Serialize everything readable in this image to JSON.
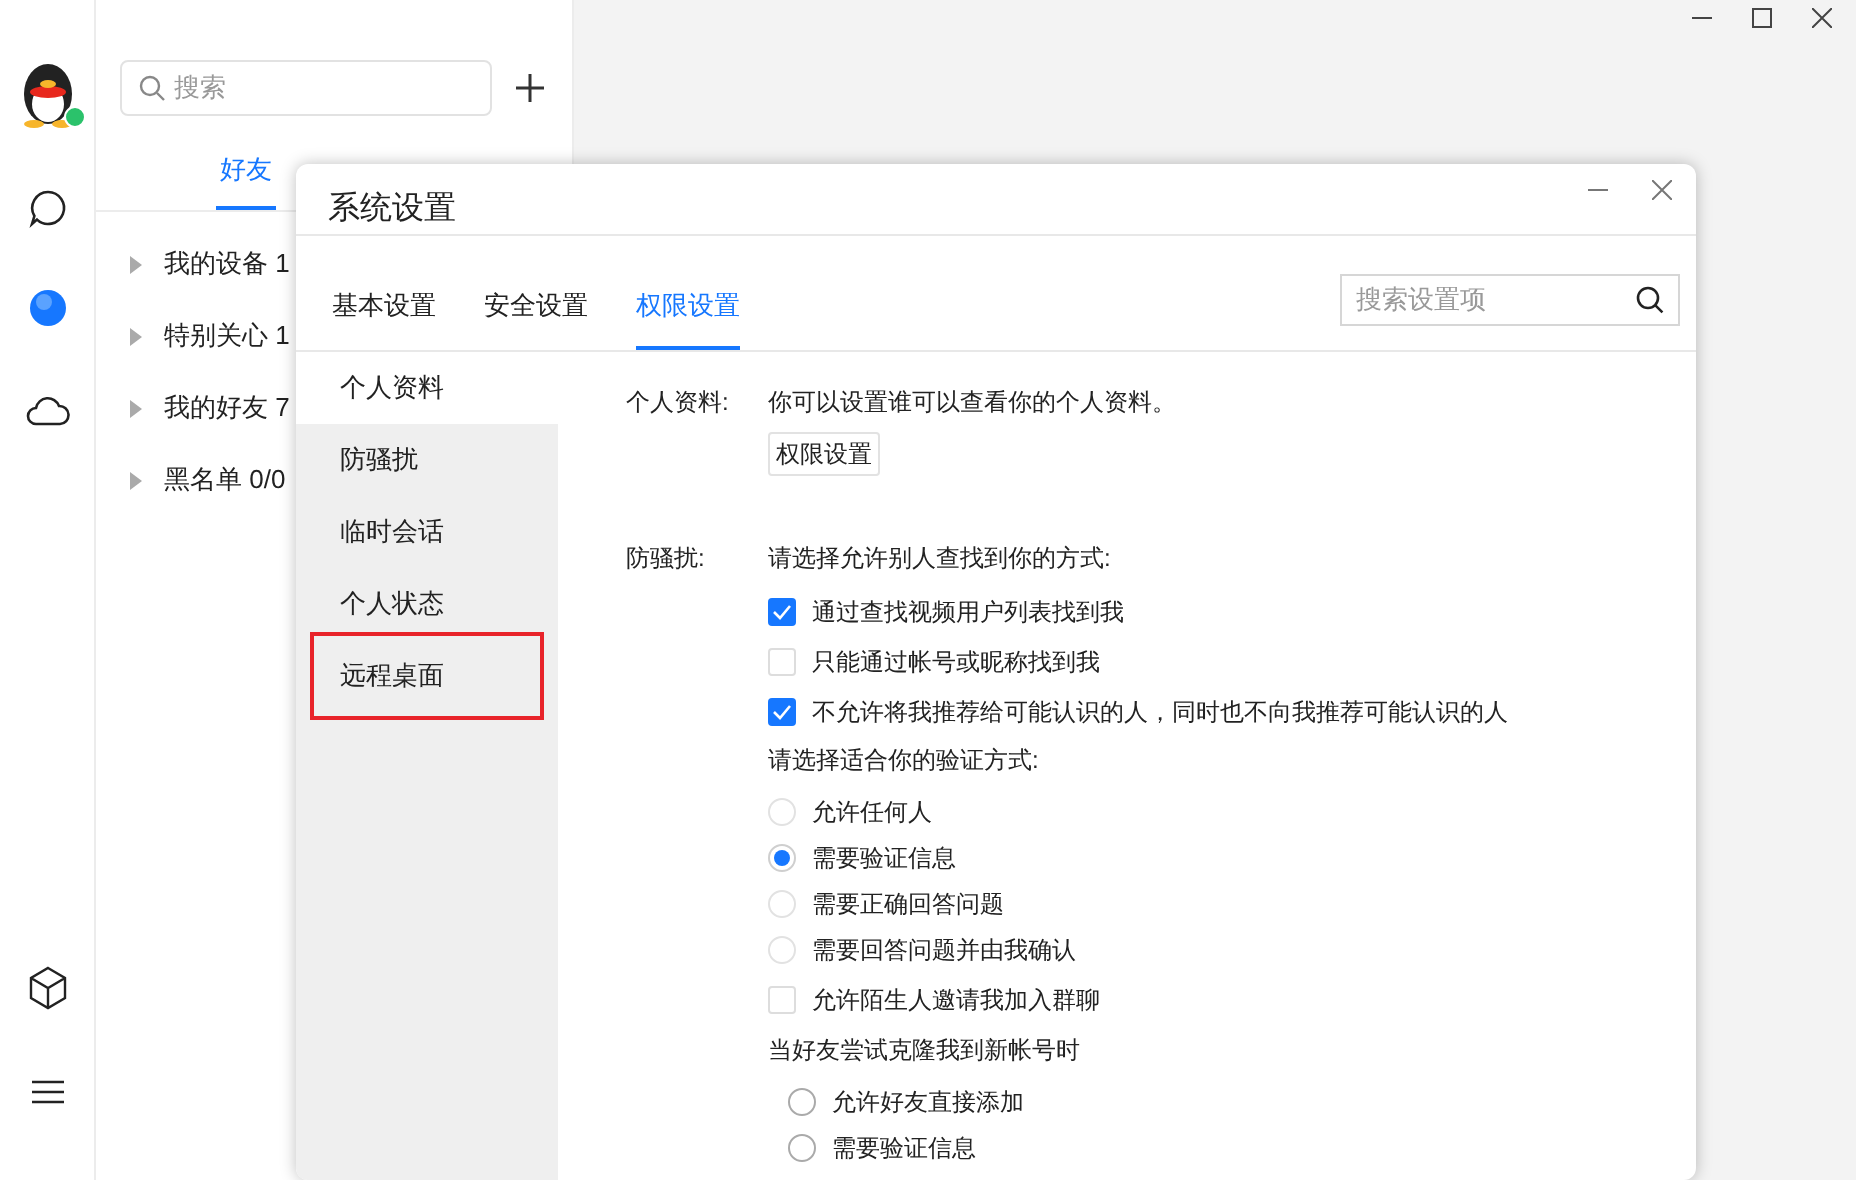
{
  "sidebar": {
    "online": true
  },
  "contacts": {
    "search_placeholder": "搜索",
    "tabs": [
      {
        "label": "好友",
        "selected": true
      }
    ],
    "groups": [
      {
        "label": "我的设备 1"
      },
      {
        "label": "特别关心 1"
      },
      {
        "label": "我的好友 7"
      },
      {
        "label": "黑名单 0/0"
      }
    ]
  },
  "dialog": {
    "title": "系统设置",
    "tabs": [
      {
        "label": "基本设置",
        "selected": false
      },
      {
        "label": "安全设置",
        "selected": false
      },
      {
        "label": "权限设置",
        "selected": true
      }
    ],
    "search_placeholder": "搜索设置项",
    "nav": [
      {
        "label": "个人资料",
        "selected": true,
        "highlighted": false
      },
      {
        "label": "防骚扰",
        "selected": false,
        "highlighted": false
      },
      {
        "label": "临时会话",
        "selected": false,
        "highlighted": false
      },
      {
        "label": "个人状态",
        "selected": false,
        "highlighted": false
      },
      {
        "label": "远程桌面",
        "selected": false,
        "highlighted": true
      }
    ],
    "profile": {
      "label": "个人资料:",
      "text": "你可以设置谁可以查看你的个人资料。",
      "button": "权限设置"
    },
    "anti_harass": {
      "label": "防骚扰:",
      "items": [
        {
          "kind": "heading",
          "text": "请选择允许别人查找到你的方式:"
        },
        {
          "kind": "checkbox",
          "text": "通过查找视频用户列表找到我",
          "checked": true
        },
        {
          "kind": "checkbox",
          "text": "只能通过帐号或昵称找到我",
          "checked": false
        },
        {
          "kind": "checkbox",
          "text": "不允许将我推荐给可能认识的人，同时也不向我推荐可能认识的人",
          "checked": true
        },
        {
          "kind": "heading",
          "text": "请选择适合你的验证方式:"
        },
        {
          "kind": "radio",
          "text": "允许任何人",
          "selected": false
        },
        {
          "kind": "radio",
          "text": "需要验证信息",
          "selected": true
        },
        {
          "kind": "radio",
          "text": "需要正确回答问题",
          "selected": false
        },
        {
          "kind": "radio",
          "text": "需要回答问题并由我确认",
          "selected": false
        },
        {
          "kind": "checkbox",
          "text": "允许陌生人邀请我加入群聊",
          "checked": false
        },
        {
          "kind": "heading",
          "text": "当好友尝试克隆我到新帐号时"
        },
        {
          "kind": "subradio",
          "text": "允许好友直接添加",
          "selected": false
        },
        {
          "kind": "subradio",
          "text": "需要验证信息",
          "selected": false
        }
      ]
    }
  }
}
